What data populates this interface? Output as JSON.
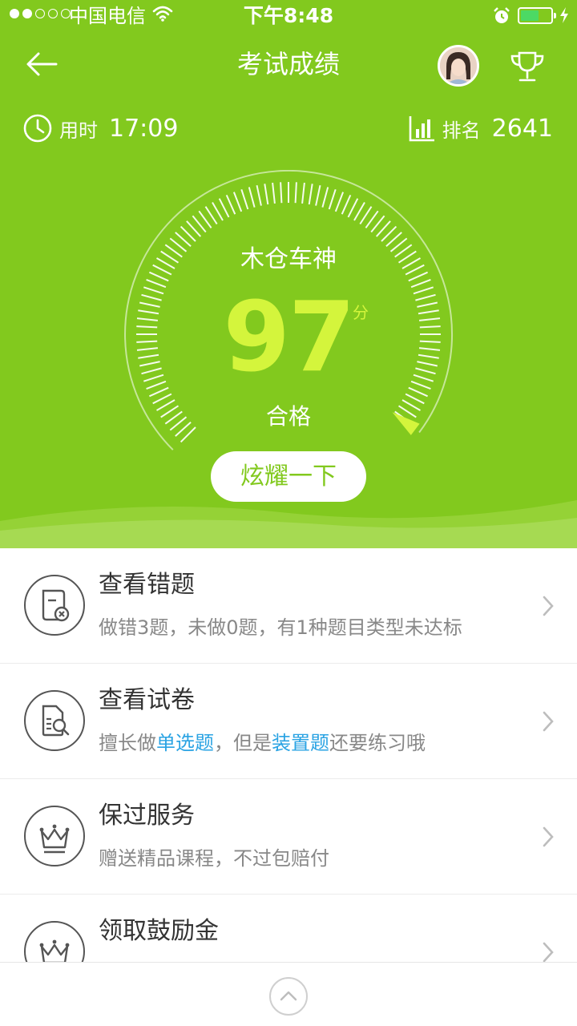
{
  "status_bar": {
    "carrier": "中国电信",
    "time": "下午8:48",
    "signal_bars_filled": 2,
    "signal_bars_total": 5,
    "battery_level": 0.5
  },
  "header": {
    "title": "考试成绩",
    "back_icon": "back-arrow-icon",
    "trophy_icon": "trophy-icon"
  },
  "stats": {
    "time_label": "用时",
    "time_value": "17:09",
    "rank_label": "排名",
    "rank_value": "2641"
  },
  "score": {
    "title": "木仓车神",
    "value": "97",
    "unit": "分",
    "result": "合格",
    "gauge_fraction": 0.97
  },
  "share_button": {
    "label": "炫耀一下"
  },
  "list": {
    "items": [
      {
        "title": "查看错题",
        "desc_parts": [
          "做错3题，未做0题，有1种题目类型未达标"
        ],
        "icon": "wrong-questions-icon"
      },
      {
        "title": "查看试卷",
        "desc_parts": [
          "擅长做",
          "单选题",
          "，但是",
          "装置题",
          "还要练习哦"
        ],
        "icon": "search-paper-icon"
      },
      {
        "title": "保过服务",
        "desc_parts": [
          "赠送精品课程，不过包赔付"
        ],
        "icon": "crown-icon"
      },
      {
        "title": "领取鼓励金",
        "desc_parts": [],
        "icon": "crown-icon"
      }
    ]
  },
  "colors": {
    "primary_green": "#82c91e",
    "score_yellow": "#d4f53c",
    "highlight_blue": "#2aa3e3"
  }
}
